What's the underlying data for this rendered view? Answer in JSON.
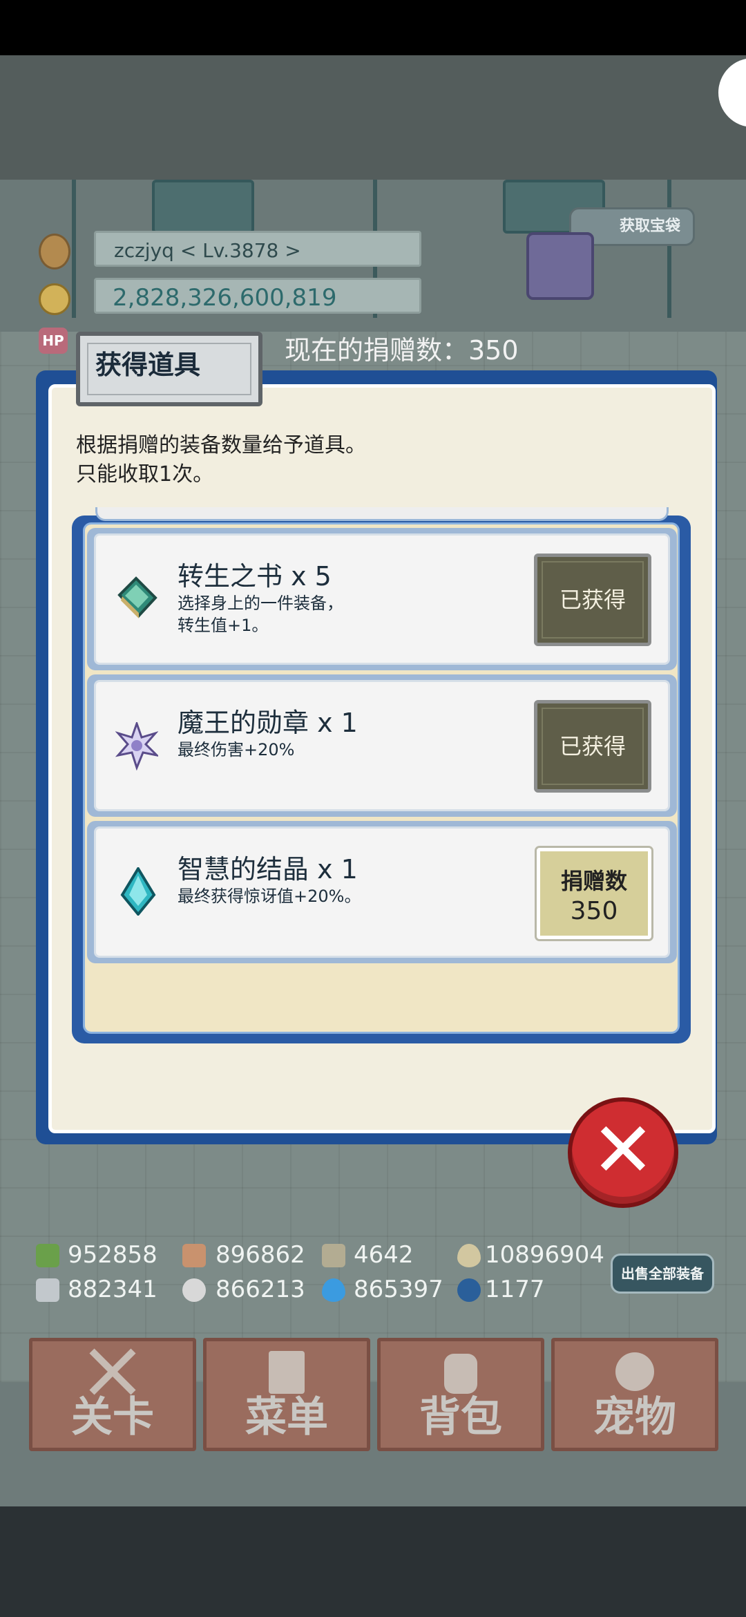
{
  "player": {
    "name_level": "zczjyq    < Lv.3878 >",
    "gold": "2,828,326,600,819",
    "hp_label": "HP"
  },
  "gift_button": {
    "label": "获取宝袋"
  },
  "donation": {
    "current_text": "现在的捐赠数：350"
  },
  "dialog": {
    "title": "获得道具",
    "description_line1": "根据捐赠的装备数量给予道具。",
    "description_line2": "只能收取1次。",
    "items": [
      {
        "name": "转生之书 x 5",
        "desc_line1": "选择身上的一件装备，",
        "desc_line2": "转生值+1。",
        "status": "已获得",
        "icon": "book-icon"
      },
      {
        "name": "魔王的勋章 x 1",
        "desc_line1": "最终伤害+20%",
        "desc_line2": "",
        "status": "已获得",
        "icon": "snowflake-medal-icon"
      },
      {
        "name": "智慧的结晶 x 1",
        "desc_line1": "最终获得惊讶值+20%。",
        "desc_line2": "",
        "status_line1": "捐赠数",
        "status_line2": "350",
        "icon": "crystal-icon"
      }
    ]
  },
  "resources": {
    "row1": [
      "952858",
      "896862",
      "4642",
      "10896904"
    ],
    "row2": [
      "882341",
      "866213",
      "865397",
      "1177"
    ]
  },
  "sell_all_button": "出售全部装备",
  "nav": [
    "关卡",
    "菜单",
    "背包",
    "宠物"
  ],
  "colors": {
    "dialog_frame": "#1f4f95",
    "obtained_button": "#5f5e49",
    "donate_button": "#d6cf9a",
    "close_button": "#cf2d31"
  }
}
